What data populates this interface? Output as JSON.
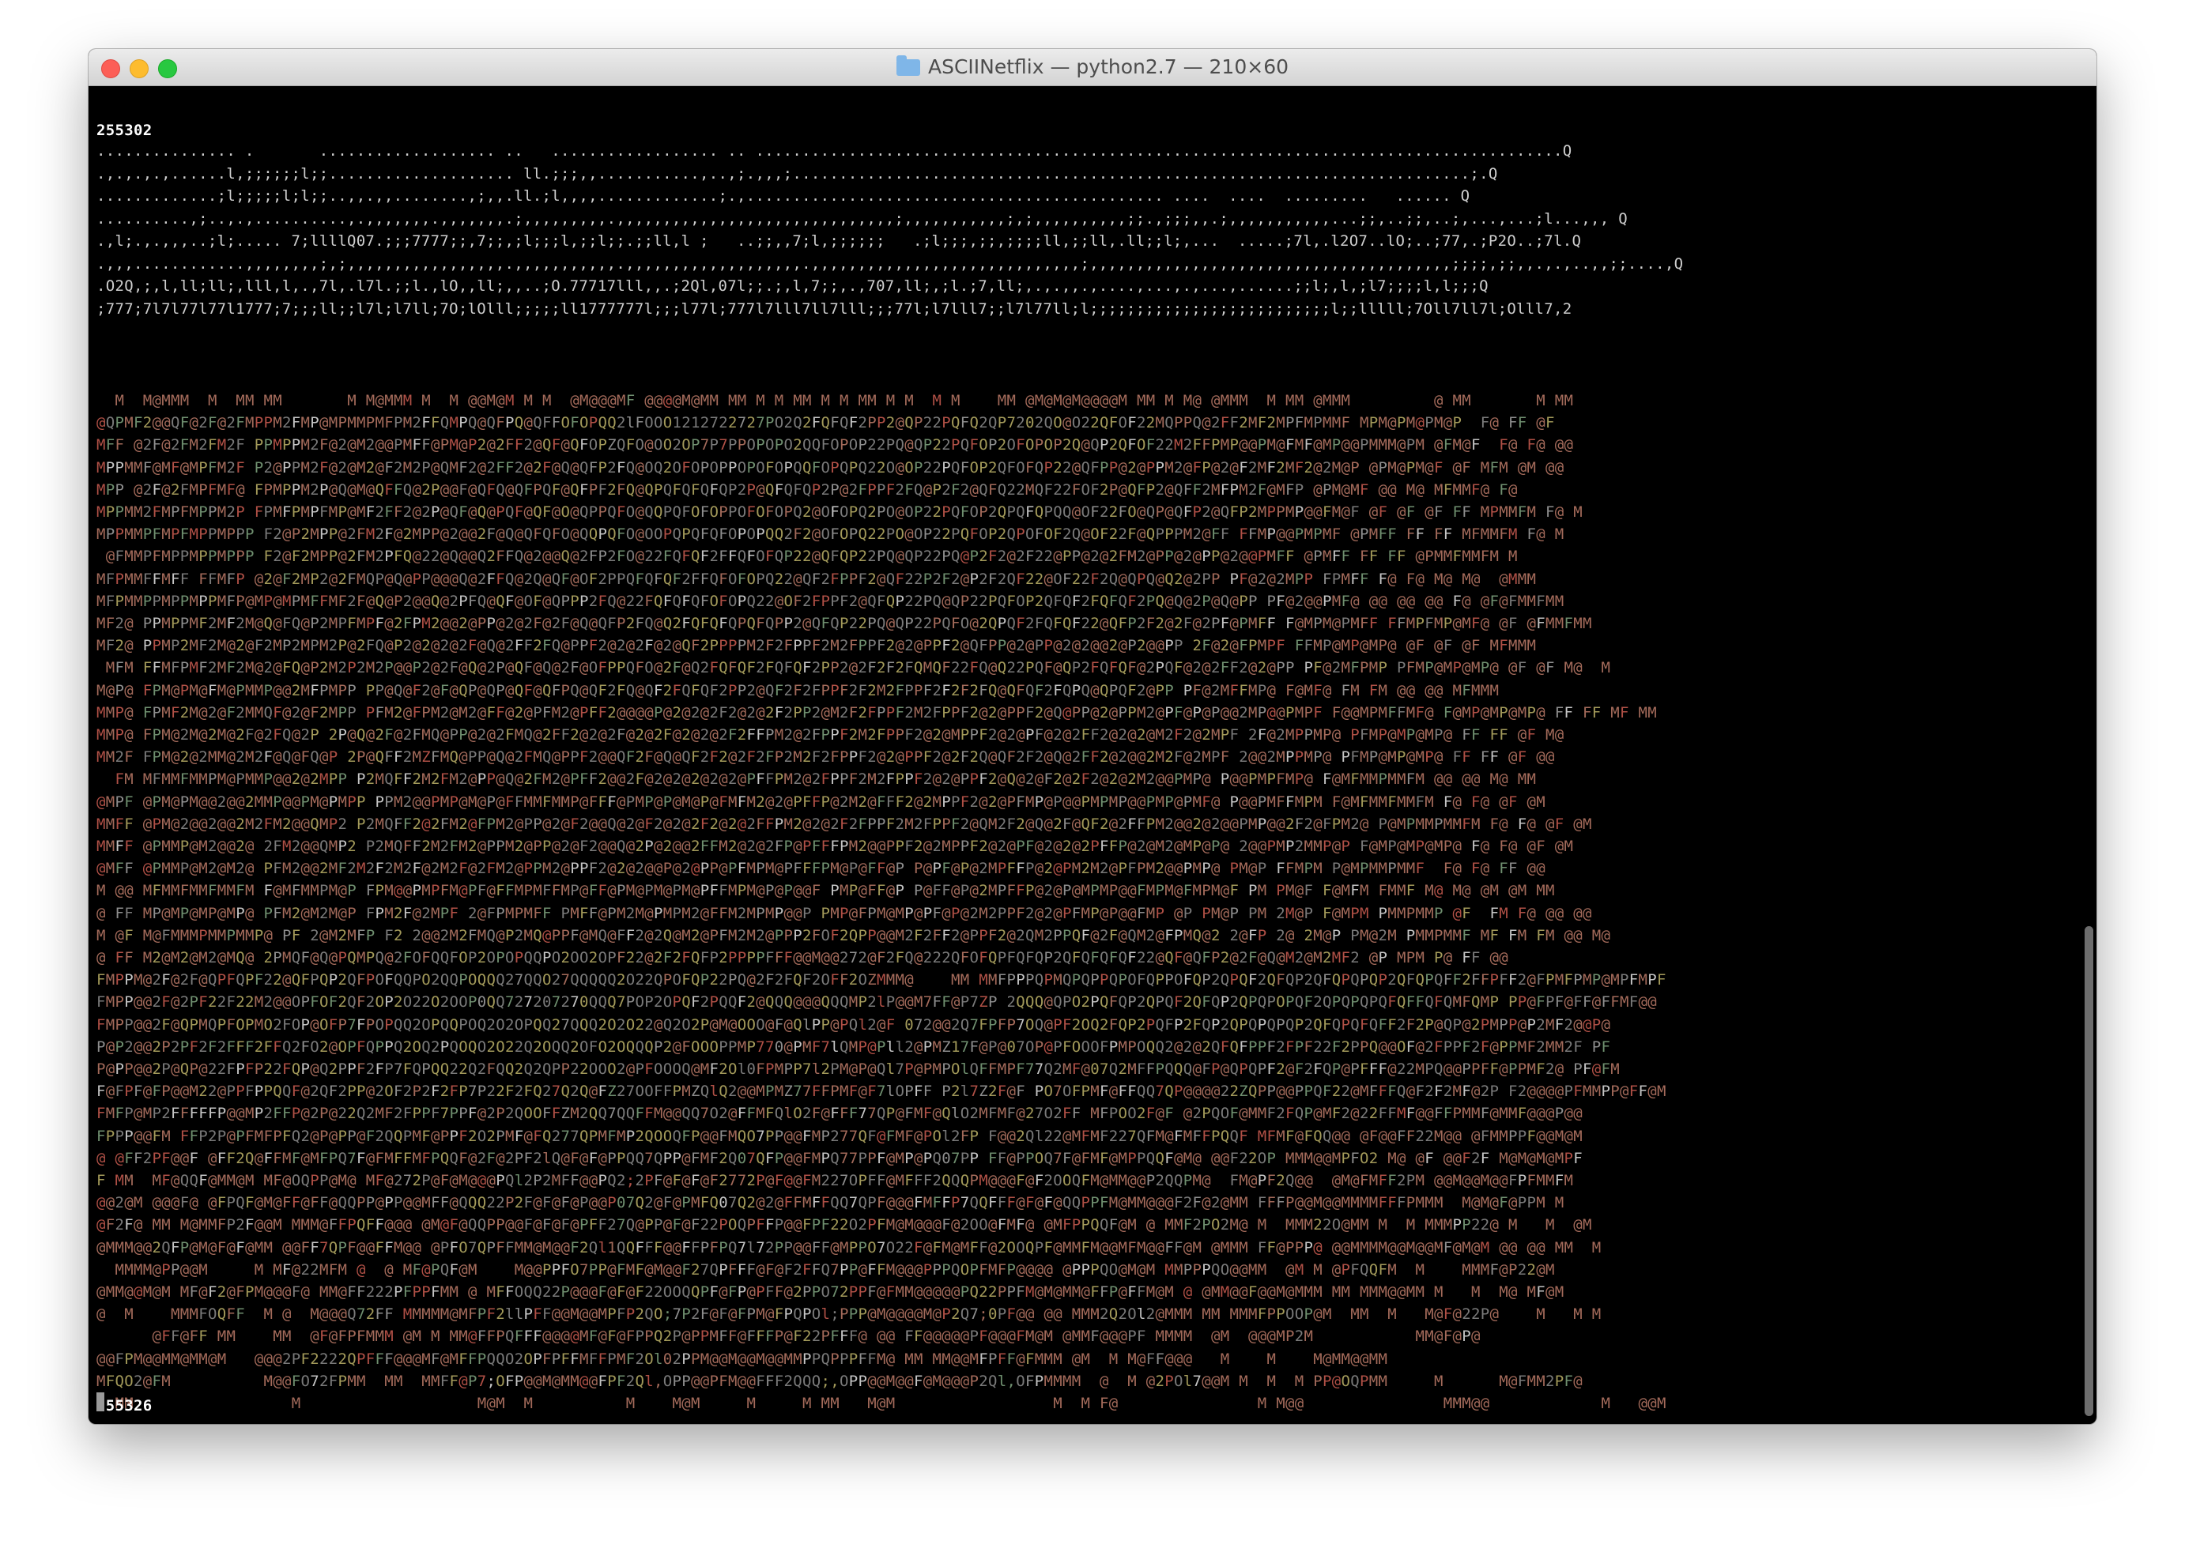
{
  "window": {
    "title": "ASCIINetflix — python2.7 — 210×60",
    "folder_icon": "folder-icon"
  },
  "terminal": {
    "frame_top": "255302",
    "dot_lines": [
      "............... .       ................... ..   .................. .. .......................................................................................Q",
      ".,.,.,.,......l,;;;;;;l;;.................... ll.;;;,,...........,..,;.,,,;.........................................................................;.Q",
      ".............;l;;;;;l;l;;..,,.,,........,;,,.ll.;l,,,,.............;.,............................................. ....  ....  .........   ...... Q",
      "..........,;..,.,..........,.,,,,,,,.,,,,,,,.;,,,,,,,,,.,,,,,,,,,,,,,,,,,,,,,,,,,,,,,,;,,,,,,,,,,,;,;,,,,,,,,,,;;.,;;;,,.;,,,,,,,,,,,...;;,..;;,..;,...,...;l...,,, Q",
      ".,l;.,.,,,..;l;..... 7;llllQ07.;;;7777;;,7;;,;l;;;l,;;l;;.;;ll,l ;   ..;;,,7;l,;;;;;;   .;l;;;,;;,;;;;ll,;;ll,.ll;;l;,...  .....;7l,.l2O7..lO;..;77,.;P2O..;7l.Q",
      ".,,,............,,,,,,,,;,;,,,,,,,,,,,,,,,,,.,,,,,,,,,,,.,,,,,,,,,,,,,,,,,,,.,,,,,,,,,,,,,,,,,,,,,,,,,,,,,;,,,,,,,,,,,,,,,,,,,,,,,,,,,,,,,,,,,,,,,;;;;,;;,,.,.,..,,;;....,Q",
      ".O2Q,;,l,ll;ll;,lll,l,.,7l,.l7l.;;l.,lO,,ll;,,..;O.77717lll,,.;2Ql,07l;;.;,l,7;;,.,707,ll;,;l.;7,ll;,.,.,,.,....,...,.,...,......;;l;,l,;l7;;;;l,l;;;Q",
      ";777;7l7l77l77l1777;7;;;ll;;l7l;l7ll;7O;lOlll;;;;;ll1777777l;;;l77l;777l7lll7ll7lll;;;77l;l7lll7;;l7l77ll;l;;;;;;;;;;;;;;;;;;;;;;;;;;l;;lllll;7Oll7ll7l;Olll7,2"
    ],
    "ascii_art_rows": [
      "  M  M@MMM  M  MM MM       M M@MMM M  M @@M@M M M  @M@@@MF @@@@M@MM MM M M MM M M MM M M  M M    MM @M@M@M@@@@M MM M M@ @MMM  M MM @MMM         @ MM       M MM",
      "@QPMF2@@QF@2F@2FMPPM2FMP@MPMMPMFPM2FFQMPQ@QFPQ@QFFOFOPQQ2lFOOO1212722727PO2Q2FQFQF2PP2@QP22PQFQ2QP7202QO@O22QFOF22MQPPQ@2FF2MF2MPFMPMMF MPM@PM@PM@P  F@ FF @F",
      "MFF @2F@2FM2FM2F PPMPPM2F@2@M2@@PMFF@PM@P2@2FF2@QF@QFOPZQFO@OO2OP7P7PPOPOPO2QQFOPOP22PQ@QP22PQFOP2OFOPOP2Q@QP2QFOF22M2FFPMP@@PM@FMF@MP@@PMMM@PM @FM@F  F@ F@ @@",
      "MPPMMF@MF@MPFM2F P2@PPM2F@2@M2@F2M2P@QMF2@2FF2@2F@Q@QFP2FQ@OQ2OFOPOPPOPOFOPQQFOPQPQ22O@OP22PQFOP2QFOFQP22@QFPP@2@PPM2@FP@2@F2MF2MF2@2M@P @PM@PM@F @F MFM @M @@",
      "MPP @2F@2FMPFMF@ FPMPPM2P@Q@M@QFFQ@2P@@F@QFQ@QFPQF@QFPF2FQ@QPQFQFQFQP2P@QFQFQP2P@2FPPF2FQ@P2F2@QFQ22MQF22FOF2P@QFP2@QFF2MFPM2F@MFP @PM@MF @@ M@ MFMMF@ F@",
      "MPPMM2FMPFMPPM2P FPMFPMPFMP@MF2FF2@2P@QF@Q@PQF@QF@O@QPPQFO@QQPQFOFOPPOFOFOPQ2@OFOPQ2PO@OP22PQFOP2QPQFQPQQ@OF22FO@QP@QFP2@QFP2MPPMP@@FM@F @F @F @F FF MPMMFM F@ M",
      "MPPMMPFMPFMPPMPPP F2@P2MPP@2FM2F@2MPP@2@@2F@Q@QFQFO@QQPQFO@OOPQPQFQFOPOPQQ2F2@OFOPQ22PO@OP22PQFOP2QPOFOF2Q@OF22F@QPPPM2@FF FFMP@@PMPMF @PMFF FF FF MFMMFM F@ M",
      " @FMMPFMPPMPPMPPP F2@F2MPP@2FM2PFQ@22@Q@@Q2FFQ@2@@Q@2FP2FO@22FQFQF2FFQFOFQP22@QFQP22PQ@QP22PQ@P2F2@2F22@PP@2@2FM2@PP@2@PP@2@@PMFF @PMFF FF FF @PMMFMMFM M",
      "MFPMMFFMFF FFMFP @2@F2MP2@2FMQP@Q@PP@@@Q@2FFQ@2Q@QF@OF2PPQFQFQF2FFQFOFOPQ22@QF2FPPF2@QF22P2F2@P2F2QF22@OF22F2Q@QPQ@Q2@2PP PF@2@2MPP FPMFF F@ F@ M@ M@  @MMM",
      "MFPMMPPMPPMPPMFP@MP@MPMFFMF2F@Q@P2@@Q@2PFQ@QF@OF@QPPP2FQ@22FQFQFQFOFOPQ22@OF2FPPF2@QFQP22PQ@QP22PQFOP2QFQF2FQFQF2PQ@Q@2P@Q@PP PF@2@@PMF@ @@ @@ @@ F@ @F@FMMFMM",
      "MF2@ PPMPPMF2MF2M@Q@FQ@P2MPFMPF@2FPM2@@2@PP@2@2F@2F@Q@QFP2FQ@Q2FQFQFQPQFQPP2@QFQP22PQ@QP22PQFO@2QPQF2FQFQF22@QFP2F2@2F@2PF@PMFF F@MPM@PMFF FFMPFMP@MF@ @F @FMMFMM",
      "MF2@ PPMP2MF2M@2@F2MP2MPM2P@2FQ@P2@2@2@2F@Q@2FF2FQ@PPF2@2@2F@2@QF2PPPPM2F2FPPF2M2FPPF2@2@PPF2@QFPP@2@PP@2@2@@2@P2@@PP 2F@2@FPMPF FFMP@MP@MP@ @F @F @F MFMMM",
      " MFM FFMFPMF2MF2M@2@FQ@P2M2P2M2P@@P2@2F@Q@2P@QF@Q@2F@OFPPQFO@2F@Q2FQFQF2FQFQF2PP2@2F2F2FQMQF22FQ@Q22PQF@QP2FQFQF@2PQF@2@2FF2@2@PP PF@2MFPMP PFMP@MP@MP@ @F @F M@  M",
      "M@P@ FPM@PM@FM@PMMP@@2MFPMPP PP@Q@F2@F@QP@QP@QF@QFPQ@QF2FQ@QF2FQFQF2PP2@QF2F2FPPF2F2M2FPPF2F2F2FQ@QFQF2FQPQ@QPQF2@PP PF@2MFFMP@ F@MF@ FM FM @@ @@ MFMMM",
      "MMP@ FPMF2M@2@F2MMQF@2@F2MPP PFM2@FPM2@M2@FF@2@PFM2@PFF2@@@@P@2@2@2F2@2@2F2PP2@M2F2FPPF2M2FPPF2@2@PPF2@Q@PP@2@PPM2@PF@P@P@@2MP@@PMPF F@@MPMFFMF@ F@MP@MP@MP@ FF FF MF MM",
      "MMP@ FPM@2M@2M@2F@2FQ@2P 2P@Q@2F@2FMQ@PP@2@2FMQ@2FF2@2@2F@2@2F@2@2@2F2FFPM2@2FPPF2M2FPPF2@2@MPPF2@2@PF@2@2FF2@2@2@M2F2@2MPF 2F@2MPPMP@ PFMP@MP@MP@ FF FF @F M@",
      "MM2F FPM@2@2MM@2M2F@Q@FQ@P 2P@QFF2MZFMQ@PP@Q@2FMQ@PPF2@@QF2F@Q@QF2F2@2F2FP2M2F2FPPF2@2@PPF2@2F2Q@QF2F2@Q@2FF2@2@@2M2F@2MPF 2@@2MPPMP@ PFMP@MP@MP@ FF FF @F @@",
      "  FM MFMMFMMPM@PMMP@@2@2MPP P2MQFF2M2FM2@PP@Q@2FM2@PFF2@@2F@2@2@2@2@2@PFFPM2@2FPPF2M2FPPF2@2@PPF2@Q@2@F2@2F2@2@2M2@@PMP@ P@@PMPFMP@ F@MFMMPMMFM @@ @@ M@ MM",
      "@MPF @PM@PM@@2@@2MMP@@PM@PMPP PPM2@@PMP@M@P@FFMMFMMP@FFF@PMP@P@M@P@FMFM2@2@PFFP@2M2@FFF2@2MPPF2@2@PFMP@P@@PMPMP@@PMP@PMF@ P@@PMFFMPM F@MFMMFMMFM F@ F@ @F @M",
      "MMFF @PM@2@@2@@2M2FM2@@QMP2 P2MQFF2@2FM2@FPM2@PP@2@F2@@Q@2@F2@2@2F2@2@2FFPM2@2@2F2FPPF2M2FPPF2@QM2F2@Q@2F@QF2@2FFPM2@@2@2@@PMP@@2F2@FPM2@ P@MPMMPMMFM F@ F@ @F @M",
      "MMFF @PMMP@M2@@2@ 2FM2@@QMP2 P2MQFF2M2FM2@PPM2@PP@2@F2@@Q@2P@2@@2FFM2@2@2FP@PFFFPM2@@PPF2@2MPPF2@2@PF@2@2@2PFFP@2@M2@MP@P@ 2@@PMP2MMP@P F@MP@MP@MP@ F@ F@ @F @M",
      "@MFF @PMMP@M2@M2@ PFM2@@2MF2M2F2M2F@2M2F@2FM2@PPM2@PPF2@2@2@@P@2@PP@PFMPM@PFFFPM@P@FF@P P@PF@P@2MPFFP@2@PM2M2@PFPM2@@PMP@ PM@P FFMPM P@MPMMPMMF  F@ F@ FF @@",
      "M @@ MFMMFMMFMMFM F@MFMMPM@P FPM@@PMPFM@PF@FFMPMFFMP@FF@PM@PM@PM@PFFMPM@P@P@@F PMP@FF@P P@FF@P@2MPFFP@2@P@MPMP@@FMPM@FMPM@F PM PM@F F@MFM FMMF M@ M@ @M @M MM",
      "@ FF MP@MP@MP@MP@ PFM2@M2M@P FPM2F@2MPF 2@FPMPMFF PMFF@PM2M@PMPM2@FFM2MPMP@@P PMP@FPM@MP@PF@P@2M2PPF2@2@PFMP@P@@FMP @P PM@P PM 2M@P F@MPM PMMPMMP @F  FM F@ @@ @@",
      "M @F M@FMMMPMMPMMP@ PF 2@M2MFP F2 2@@2M2FMQ@P2MQ@PPF@MQ@FF2@2Q@M2@PFM2M2@PPP2FOF2QPP@@M2F2FF2@PPF2@2QM2PPQF@2F@QM2@FPMQ@2 2@FP 2@ 2M@P PM@2M PMMPMMF MF FM FM @@ M@",
      "@ FF M2@M2@M2@MQ@ 2PMQF@Q@PQMPQ@2FOFQQFOP2OPOPQQPO2OO2OPF22@2F2FQFP2PPPPFFF@@M@@272@F2FQ@222QFOFQPFQFQP2QFQFQFQF22@QF@QFP2@2F@Q@M2@M2MF2 @P MPM P@ FF @@",
      "FMPPM@2F@2F@QPFQPF22@QFPQP2QFPOFQQPO2QQPOQQQ27QQO27QQQQQ2O22QPOFQP22PQ@2F2FQF2OFF2OZMMM@    MM MMFPPPQPMQPQPPQPOFQPPOFQP2QPQF2QFQP2QFQPQPQP2QFQPQFF2FFPFF2@FPMFPMP@MPFMPF",
      "FMPP@@2F@2PF22F22M2@@OPFOF2QF2OP2O22O2OOP0QQ727207270QQQ7POP2OPQF2PQQF2@QQQ@@@QQQMP2lP@@M7FF@P7ZP 2QQQ@QPO2PQFQP2QPQF2QFQP2QPQPOPQF2QPQPQPQFQFFQFQMFQMP PP@FPF@FF@FFMF@@",
      "FMPP@@2F@QPMQPFOPMO2FOP@OFP7FPOPQQ2OPQQPOQ2O2OPQQ27QQQ2O2O22@Q2O2P@M@OOO@F@QlPP@PQl2@F 072@@2Q7FPFP7OQ@PF2OQ2FQP2PQFP2FQP2QPQPQPQP2QFQPQFQFF2F2P@QP@2PMPP@P2MF2@@P@",
      "P@P2@@2P2PF2F2FFF2FFQ2FO2@OPFQPPQ2OQ2PQOQO2O22Q2OQQ2OFO2OQQQP2@FOOOPPMP770@PMF7lQMP@Pll2@PMZ17F@P@07OP@PFOOOFPMPOQQ2@2@2QFQFPPF2FPF22F2PPQ@@OF@2FPPF2F@PPMF2MM2F PF",
      "P@PP@@2P@QP@22FPFP22FQP@Q2PPF2FP7FQPQQ22Q2FQQ2Q2QPP22OOO2@PFOOOQ@MF2Ol0FPMPP7l2PM@P@Ql7P@PMPOlQFFMPF77Q2MF@07Q2MFFPQQQ@FP@QPQPF2@F2FQP@PFFF@22MPQ@@PPFF@PPMF2@ PF@FM",
      "F@FPF@FP@@M22@PPFPPQQF@2QF2PP@2OF2P2F2FP7P22F2FQ27Q2Q@FZ27OOFFPMZQlQ2@@MPMZ77FFPMF@F7lOPFF P2l7Z2F@F PO7OFPMF@FFQQ7QP@@@@22ZQPP@@PPQF22@MFFFQ@F2F2MF@2P F2@@@@PFMMPP@FF@M",
      "FMFP@MP2FFFFFP@@MP2FFP@2P@22Q2MF2FPPF7PPF@2P2QOOFFZM2QQ7QQFFM@@QQ7O2@FFMFQlO2F@FFF77QP@FMF@QlO2MFMF@27O2FF MFPOO2F@F @2PQOF@MMF2FQP@MF2@22FFMF@@FFPMMF@MMF@@@P@@",
      "FPPP@@FM FFP2P@PFMFPFQ2@P@PP@F2QQPMF@PPF2O2PMF@FQ277QPMFMP2QOOQFP@@FMQO7PP@@FMP277QF@FMF@POl2FP F@@2Ql22@MFMF227QFM@FMFFPQQF MFMF@FQQ@@ @F@@FF22M@@ @FMMPPF@@M@M",
      "@ @FF2PF@@F @FF2Q@FFMF@MFPQ7F@FMFFMFPQQF@2F@2PF2lQ@F@F@PPQQ7QPP@FMF2Q07QFP@@FMPQ77PPF@MP@PQ07PP FF@PPOQ7F@FMF@MPPQQF@M@ @@F22OP MMM@@MPFO2 M@ @F @@F2F M@M@M@MPF",
      "F MM  MF@QQF@MM@M MF@OQPP@M@ MF@272P@F@M@@@PQl2P2MFF@@PQ2;2PF@F@F@F2772P@F@@FM227OPFF@MFFF2QQQPM@@@F@F2OOQFM@MM@@P2QQPM@  FM@PF2Q@@  @M@FMFF2PM @@M@@M@@FPFMMFM",
      "@@2@M @@@F@ @FPQF@M@FF@FF@QQPP@PP@@MFF@QQQ22P2F@F@F@P@@P07Q2@F@PMFQ07Q2@2@FFMFFQQ7QPF@@@FMFFP7QQFFF@F@F@QQPPFM@MM@@@F2F@2@MM FFFP@@M@@MMMMFFFPMMM  M@M@F@PPM M",
      "@F2F@ MM M@MMFP2F@@M MMM@FFPQFF@@@ @M@F@QQPP@@F@F@F@PFF27Q@PP@F@F22POQPFFP@@FPF22O2PFM@M@@@F@2OO@FMF@ @MFPPQQF@M @ MMF2PO2M@ M  MMM22O@MM M  M MMMPP22@ M   M  @M",
      "@MMM@@2QFP@M@F@F@MM @@FF7QPF@@FFM@@ @PFO7QPFFMM@M@@F2Ql1QQFFF@@FFPFPQ7l72PP@@FF@MPPO7O22F@FM@MFF@2OOQPF@MMFM@@MFM@@FF@M @MMM FF@PPP@ @@MMMM@@M@@MF@M@M @@ @@ MM  M",
      "  MMMM@PP@@M     M MF@22MFM @  @ MF@PQF@M    M@@PPFO7PP@FMF@M@@F27QPFFF@F@F2FFQ7PP@FFM@@@PPPQOPFMFP@@@@ @PPPQO@M@M MMPPPQO@@MM  @M M @PFQQFM  M    MMMF@P22@M",
      "@MM@@M@M MF@F2@FPM@@@F@ MM@FF222PFPPFMM @ MFFOQQ22P@@@F@F@F22OOQQPF@FP@PFF@2PPO72PPF@FMM@@@@@PQ22PPFM@M@MM@FFP@FFM@M @ @MM@@F@@M@MMM MM MMM@@MM M   M  M@ MF@M",
      "@  M    MMMFOQFF  M @  M@@@Q72FF MMMMM@MFPF2llPFF@@M@@MPFP2QO;7P2F@F@FPM@FPQPOl;PPP@M@@@@M@P2Q7;0PF@@ @@ MMM2Q2Ol2@MMM MM MMMFPPOOP@M  MM  M   M@F@22P@    M   M M",
      "      @FF@FF MM    MM  @F@FPFMMM @M M MM@FFPQFFF@@@@MF@F@FPPQ2P@PPMFF@FFFP@F22PFFF@ @@ FF@@@@@PF@@@FM@M @MMF@@@PF MMMM  @M  @@@MP2M           MM@F@P@",
      "@@FPM@@MM@MM@M   @@@2PF2222QPFFF@@@MF@MFFPQQO2OPFPFFMFFPMF2Ol02PPM@@M@@M@@MMPPQPPPFFM@ MM MM@@MFPFF@FMMM @M  M M@FF@@@   M    M    M@MM@@MM",
      "MFQO2@FM          M@@FO72FPMM  MM  MMFF@P7;OFP@@M@MM@@FPF2Ql,OPP@@PFM@@FFF2QQQ;,OPP@@M@@F@M@@@P2Ql,OFPMMMM  @  M @2POl7@@M M  M  M PP@OQPMM     M      M@FMM2PF@",
      "  MM                 M                   M@M  M          M    M@M     M     M MM   M@M                 M  M F@               M M@@               MMM@@            M   @@M"
    ],
    "frame_bottom": "255326"
  },
  "ascii_palette": [
    "#8e8e8e",
    "#7a7a7a",
    "#a36a5a",
    "#b05046",
    "#a39a5a",
    "#6f8f6f",
    "#c5c5c5"
  ]
}
